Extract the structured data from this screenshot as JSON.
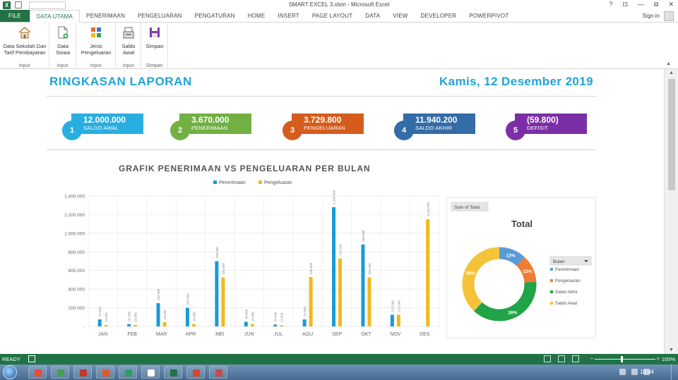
{
  "window": {
    "title": "SMART EXCEL 3.xlsm - Microsoft Excel",
    "help": "?",
    "controls": [
      "⊡",
      "—",
      "⧉",
      "✕"
    ]
  },
  "ribbon_tabs": [
    {
      "label": "FILE"
    },
    {
      "label": "DATA UTAMA"
    },
    {
      "label": "PENERIMAAN"
    },
    {
      "label": "PENGELUARAN"
    },
    {
      "label": "PENGATURAN"
    },
    {
      "label": "HOME"
    },
    {
      "label": "INSERT"
    },
    {
      "label": "PAGE LAYOUT"
    },
    {
      "label": "DATA"
    },
    {
      "label": "VIEW"
    },
    {
      "label": "DEVELOPER"
    },
    {
      "label": "POWERPIVOT"
    }
  ],
  "sign_in": "Sign in",
  "ribbon": {
    "buttons": {
      "data_sekolah": {
        "line1": "Data Sekolah Dan",
        "line2": "Tarif Pembayaran"
      },
      "data_siswa": {
        "line1": "Data",
        "line2": "Siswa"
      },
      "jenis_pengeluaran": {
        "line1": "Jenis",
        "line2": "Pengeluaran"
      },
      "saldo_awal": {
        "line1": "Saldo",
        "line2": "Awal"
      },
      "simpan": {
        "line1": "Simpan",
        "line2": ""
      }
    },
    "groups": [
      "Input",
      "Input",
      "Input",
      "Input",
      "Simpan"
    ],
    "icons": [
      "home-icon",
      "document-add-icon",
      "category-grid-icon",
      "cash-register-icon",
      "save-icon"
    ]
  },
  "report": {
    "title": "RINGKASAN LAPORAN",
    "date": "Kamis, 12 Desember 2019",
    "kpis": [
      {
        "num": "1",
        "value": "12.000.000",
        "label": "SALDO AWAL",
        "color": "#29aee0"
      },
      {
        "num": "2",
        "value": "3.670.000",
        "label": "PENERIMAAN",
        "color": "#72b043"
      },
      {
        "num": "3",
        "value": "3.729.800",
        "label": "PENGELUARAN",
        "color": "#d55c1c"
      },
      {
        "num": "4",
        "value": "11.940.200",
        "label": "SALDO AKHIR",
        "color": "#336ca6"
      },
      {
        "num": "5",
        "value": "(59.800)",
        "label": "DEFISIT",
        "color": "#7b2fa6"
      }
    ]
  },
  "chart_data": [
    {
      "type": "bar",
      "title": "GRAFIK PENERIMAAN VS PENGELUARAN PER BULAN",
      "categories": [
        "JAN",
        "FEB",
        "MAR",
        "APR",
        "MEI",
        "JUN",
        "JUL",
        "AGU",
        "SEP",
        "OKT",
        "NOV",
        "DES"
      ],
      "series": [
        {
          "name": "Penerimaan",
          "color": "#1a9bd7",
          "values": [
            75000,
            25000,
            250000,
            200000,
            700000,
            50000,
            20000,
            75000,
            1280000,
            880000,
            125000,
            0
          ],
          "labels": [
            "75.000",
            "25.000",
            "250.000",
            "200.000",
            "700.000",
            "50.000",
            "20.000",
            "75.000",
            "1.280.000",
            "880.000",
            "125.000",
            "-"
          ]
        },
        {
          "name": "Pengeluaran",
          "color": "#f2b91c",
          "values": [
            15000,
            15000,
            45000,
            25000,
            525000,
            25000,
            12500,
            530000,
            729500,
            525000,
            125000,
            1150000
          ],
          "labels": [
            "15.000",
            "15.000",
            "45.000",
            "25.000",
            "525.000",
            "25.000",
            "12.500",
            "530.000",
            "729.500",
            "525.000",
            "125.000",
            "1.150.000"
          ]
        }
      ],
      "ylim": [
        0,
        1400000
      ],
      "yticks": [
        "-",
        "200.000",
        "400.000",
        "600.000",
        "800.000",
        "1.000.000",
        "1.200.000",
        "1.400.000"
      ],
      "legend": "top",
      "grid": true
    },
    {
      "type": "pie",
      "title": "Total",
      "field_button": "Sum of Total",
      "legend_title": "Bulan",
      "legend": "right",
      "slices": [
        {
          "name": "Penerimaan",
          "value": 12,
          "label": "12%",
          "color": "#5b9bd5"
        },
        {
          "name": "Pengeluaran",
          "value": 12,
          "label": "12%",
          "color": "#ed7d31"
        },
        {
          "name": "Saldo Akhir",
          "value": 38,
          "label": "38%",
          "color": "#21a348"
        },
        {
          "name": "Saldo Awal",
          "value": 38,
          "label": "38%",
          "color": "#f4c33a"
        }
      ]
    }
  ],
  "status": {
    "ready": "READY",
    "zoom_minus": "−",
    "zoom_plus": "+",
    "zoom": "100%"
  },
  "taskbar": {
    "clock": "10:44",
    "app_colors": [
      "#e94b2c",
      "#3fa34d",
      "#c0392b",
      "#e2582a",
      "#2e9e5b",
      "#ffffff",
      "#217346",
      "#d9452b",
      "#c94a4a"
    ]
  }
}
